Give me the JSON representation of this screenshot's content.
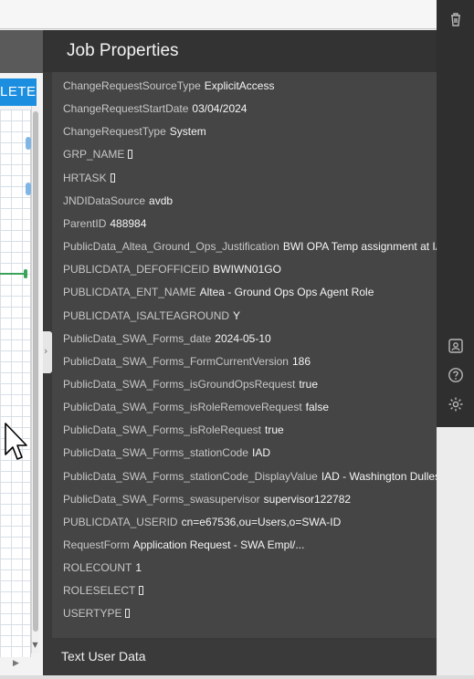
{
  "background": {
    "complete_button_label": "LETE"
  },
  "panel": {
    "title": "Job Properties",
    "collapse_glyph": "›",
    "properties": [
      {
        "key": "ChangeRequestSourceType",
        "value": "ExplicitAccess"
      },
      {
        "key": "ChangeRequestStartDate",
        "value": "03/04/2024"
      },
      {
        "key": "ChangeRequestType",
        "value": "System"
      },
      {
        "key": "GRP_NAME",
        "value": "[]"
      },
      {
        "key": "HRTASK",
        "value": "[]"
      },
      {
        "key": "JNDIDataSource",
        "value": "avdb"
      },
      {
        "key": "ParentID",
        "value": "488984"
      },
      {
        "key": "PublicData_Altea_Ground_Ops_Justification",
        "value": "BWI OPA Temp assignment at IAD"
      },
      {
        "key": "PUBLICDATA_DEFOFFICEID",
        "value": "BWIWN01GO"
      },
      {
        "key": "PUBLICDATA_ENT_NAME",
        "value": "Altea - Ground Ops Ops Agent Role"
      },
      {
        "key": "PUBLICDATA_ISALTEAGROUND",
        "value": "Y"
      },
      {
        "key": "PublicData_SWA_Forms_date",
        "value": "2024-05-10"
      },
      {
        "key": "PublicData_SWA_Forms_FormCurrentVersion",
        "value": "186"
      },
      {
        "key": "PublicData_SWA_Forms_isGroundOpsRequest",
        "value": "true"
      },
      {
        "key": "PublicData_SWA_Forms_isRoleRemoveRequest",
        "value": "false"
      },
      {
        "key": "PublicData_SWA_Forms_isRoleRequest",
        "value": "true"
      },
      {
        "key": "PublicData_SWA_Forms_stationCode",
        "value": "IAD"
      },
      {
        "key": "PublicData_SWA_Forms_stationCode_DisplayValue",
        "value": "IAD - Washington Dulles Interna..."
      },
      {
        "key": "PublicData_SWA_Forms_swasupervisor",
        "value": "supervisor122782"
      },
      {
        "key": "PUBLICDATA_USERID",
        "value": "cn=e67536,ou=Users,o=SWA-ID"
      },
      {
        "key": "RequestForm",
        "value": "Application Request - SWA Empl/..."
      },
      {
        "key": "ROLECOUNT",
        "value": "1"
      },
      {
        "key": "ROLESELECT",
        "value": "[]"
      },
      {
        "key": "USERTYPE",
        "value": "[]"
      }
    ],
    "section_title": "Text User Data"
  },
  "toolbar_icons": [
    "trash-icon",
    "id-card-icon",
    "help-icon",
    "settings-icon"
  ],
  "colors": {
    "panel_bg": "#3a3a3a",
    "props_bg": "#454545",
    "accent_blue": "#1b8ee0",
    "connector_green": "#3aa35a"
  }
}
